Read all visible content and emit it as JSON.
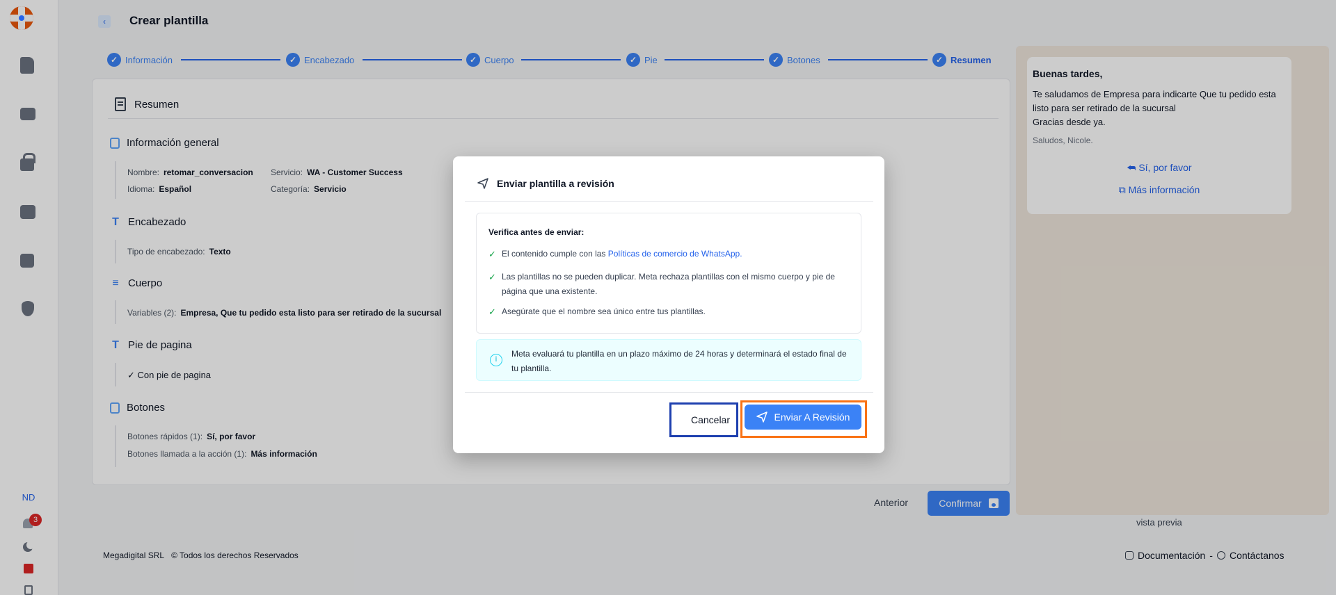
{
  "app": {
    "title": "Crear plantilla",
    "user_initials": "ND",
    "notifications_count": "3"
  },
  "sidebar": {
    "items": [
      "document-icon",
      "contacts-icon",
      "lock-icon",
      "wallet-icon",
      "book-icon",
      "shield-icon"
    ]
  },
  "stepper": {
    "steps": [
      "Información",
      "Encabezado",
      "Cuerpo",
      "Pie",
      "Botones",
      "Resumen"
    ],
    "active": "Resumen"
  },
  "summary": {
    "title": "Resumen",
    "general": {
      "title": "Información general",
      "name_label": "Nombre:",
      "name_value": "retomar_conversacion",
      "service_label": "Servicio:",
      "service_value": "WA - Customer Success",
      "language_label": "Idioma:",
      "language_value": "Español",
      "category_label": "Categoría:",
      "category_value": "Servicio"
    },
    "header": {
      "title": "Encabezado",
      "type_label": "Tipo de encabezado:",
      "type_value": "Texto"
    },
    "body": {
      "title": "Cuerpo",
      "vars_label": "Variables (2):",
      "vars_value": "Empresa, Que tu pedido esta listo para ser retirado de la sucursal"
    },
    "footer": {
      "title": "Pie de pagina",
      "value": "✓ Con pie de pagina"
    },
    "buttons": {
      "title": "Botones",
      "quick_label": "Botones rápidos (1):",
      "quick_value": "Sí, por favor",
      "cta_label": "Botones llamada a la acción (1):",
      "cta_value": "Más información"
    }
  },
  "preview": {
    "title": "Buenas tardes,",
    "body_line1": "Te saludamos de Empresa para indicarte Que tu pedido esta listo para ser retirado de la sucursal",
    "body_line2": "Gracias desde ya.",
    "footer": "Saludos, Nicole.",
    "quick_reply": "Sí, por favor",
    "cta": "Más información",
    "label": "vista previa",
    "bg_color": "#efe7dc"
  },
  "actions": {
    "previous": "Anterior",
    "confirm": "Confirmar"
  },
  "footer": {
    "company": "Megadigital SRL",
    "rights": "© Todos los derechos Reservados",
    "docs": "Documentación",
    "separator": "-",
    "contact": "Contáctanos"
  },
  "modal": {
    "title": "Enviar plantilla a revisión",
    "verify_title": "Verifica antes de enviar:",
    "item1_prefix": "El contenido cumple con las ",
    "item1_link": "Políticas de comercio de WhatsApp.",
    "item2": "Las plantillas no se pueden duplicar. Meta rechaza plantillas con el mismo cuerpo y pie de página que una existente.",
    "item3": "Asegúrate que el nombre sea único entre tus plantillas.",
    "info": "Meta evaluará tu plantilla en un plazo máximo de 24 horas y determinará el estado final de tu plantilla.",
    "cancel": "Cancelar",
    "submit": "Enviar A Revisión"
  },
  "colors": {
    "accent": "#3b82f6",
    "highlight_cancel": "#1e40af",
    "highlight_submit": "#f97316"
  }
}
